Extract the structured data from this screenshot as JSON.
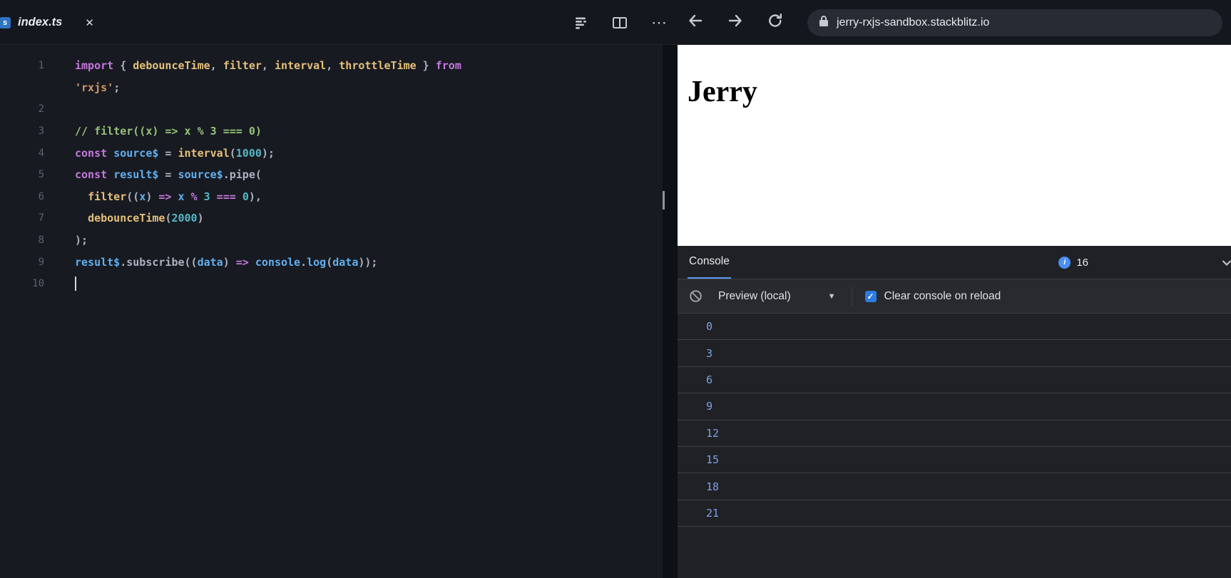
{
  "topbar": {
    "tab": {
      "title": "index.ts",
      "icon_letter": "s"
    },
    "url": "jerry-rxjs-sandbox.stackblitz.io"
  },
  "icons": {
    "close": "✕",
    "ellipsis": "⋯",
    "dropdown": "▼",
    "check": "✓",
    "info": "i"
  },
  "preview": {
    "heading": "Jerry"
  },
  "console": {
    "title": "Console",
    "count": "16",
    "context": "Preview (local)",
    "checkbox_label": "Clear console on reload",
    "rows": [
      "0",
      "3",
      "6",
      "9",
      "12",
      "15",
      "18",
      "21"
    ]
  },
  "colors": {
    "accent_blue": "#5b9cf5",
    "checkbox_blue": "#2d7ce0",
    "console_log_text": "#7d9fe8",
    "keyword": "#c678dd",
    "function": "#e5c07b",
    "variable": "#61afef",
    "number": "#56b6c2",
    "string": "#d19a66",
    "comment": "#98c379"
  },
  "editor": {
    "lines": [
      {
        "num": "1",
        "tokens": [
          [
            "kw",
            "import"
          ],
          [
            "pun",
            " { "
          ],
          [
            "fn",
            "debounceTime"
          ],
          [
            "pun",
            ", "
          ],
          [
            "fn",
            "filter"
          ],
          [
            "pun",
            ", "
          ],
          [
            "fn",
            "interval"
          ],
          [
            "pun",
            ", "
          ],
          [
            "fn",
            "throttleTime"
          ],
          [
            "pun",
            " } "
          ],
          [
            "kw",
            "from"
          ]
        ]
      },
      {
        "num": "",
        "tokens": [
          [
            "str",
            "'rxjs'"
          ],
          [
            "pun",
            ";"
          ]
        ]
      },
      {
        "num": "2",
        "tokens": []
      },
      {
        "num": "3",
        "tokens": [
          [
            "com",
            "// filter((x) => x % 3 === 0)"
          ]
        ]
      },
      {
        "num": "4",
        "tokens": [
          [
            "kw",
            "const"
          ],
          [
            "pun",
            " "
          ],
          [
            "var",
            "source$"
          ],
          [
            "pun",
            " = "
          ],
          [
            "fn",
            "interval"
          ],
          [
            "pun",
            "("
          ],
          [
            "num",
            "1000"
          ],
          [
            "pun",
            ");"
          ]
        ]
      },
      {
        "num": "5",
        "tokens": [
          [
            "kw",
            "const"
          ],
          [
            "pun",
            " "
          ],
          [
            "var",
            "result$"
          ],
          [
            "pun",
            " = "
          ],
          [
            "var",
            "source$"
          ],
          [
            "pun",
            ".pipe("
          ]
        ]
      },
      {
        "num": "6",
        "tokens": [
          [
            "pun",
            "  "
          ],
          [
            "fn",
            "filter"
          ],
          [
            "pun",
            "(("
          ],
          [
            "var",
            "x"
          ],
          [
            "pun",
            ") "
          ],
          [
            "kw",
            "=>"
          ],
          [
            "pun",
            " "
          ],
          [
            "var",
            "x"
          ],
          [
            "op",
            " % "
          ],
          [
            "num",
            "3"
          ],
          [
            "op",
            " === "
          ],
          [
            "num",
            "0"
          ],
          [
            "pun",
            "),"
          ]
        ]
      },
      {
        "num": "7",
        "tokens": [
          [
            "pun",
            "  "
          ],
          [
            "fn",
            "debounceTime"
          ],
          [
            "pun",
            "("
          ],
          [
            "num",
            "2000"
          ],
          [
            "pun",
            ")"
          ]
        ]
      },
      {
        "num": "8",
        "tokens": [
          [
            "pun",
            ");"
          ]
        ]
      },
      {
        "num": "9",
        "tokens": [
          [
            "var",
            "result$"
          ],
          [
            "pun",
            ".subscribe(("
          ],
          [
            "var",
            "data"
          ],
          [
            "pun",
            ") "
          ],
          [
            "kw",
            "=>"
          ],
          [
            "pun",
            " "
          ],
          [
            "var",
            "console"
          ],
          [
            "pun",
            "."
          ],
          [
            "var",
            "log"
          ],
          [
            "pun",
            "("
          ],
          [
            "var",
            "data"
          ],
          [
            "pun",
            "));"
          ]
        ]
      },
      {
        "num": "10",
        "tokens": [],
        "cursor": true
      }
    ]
  }
}
